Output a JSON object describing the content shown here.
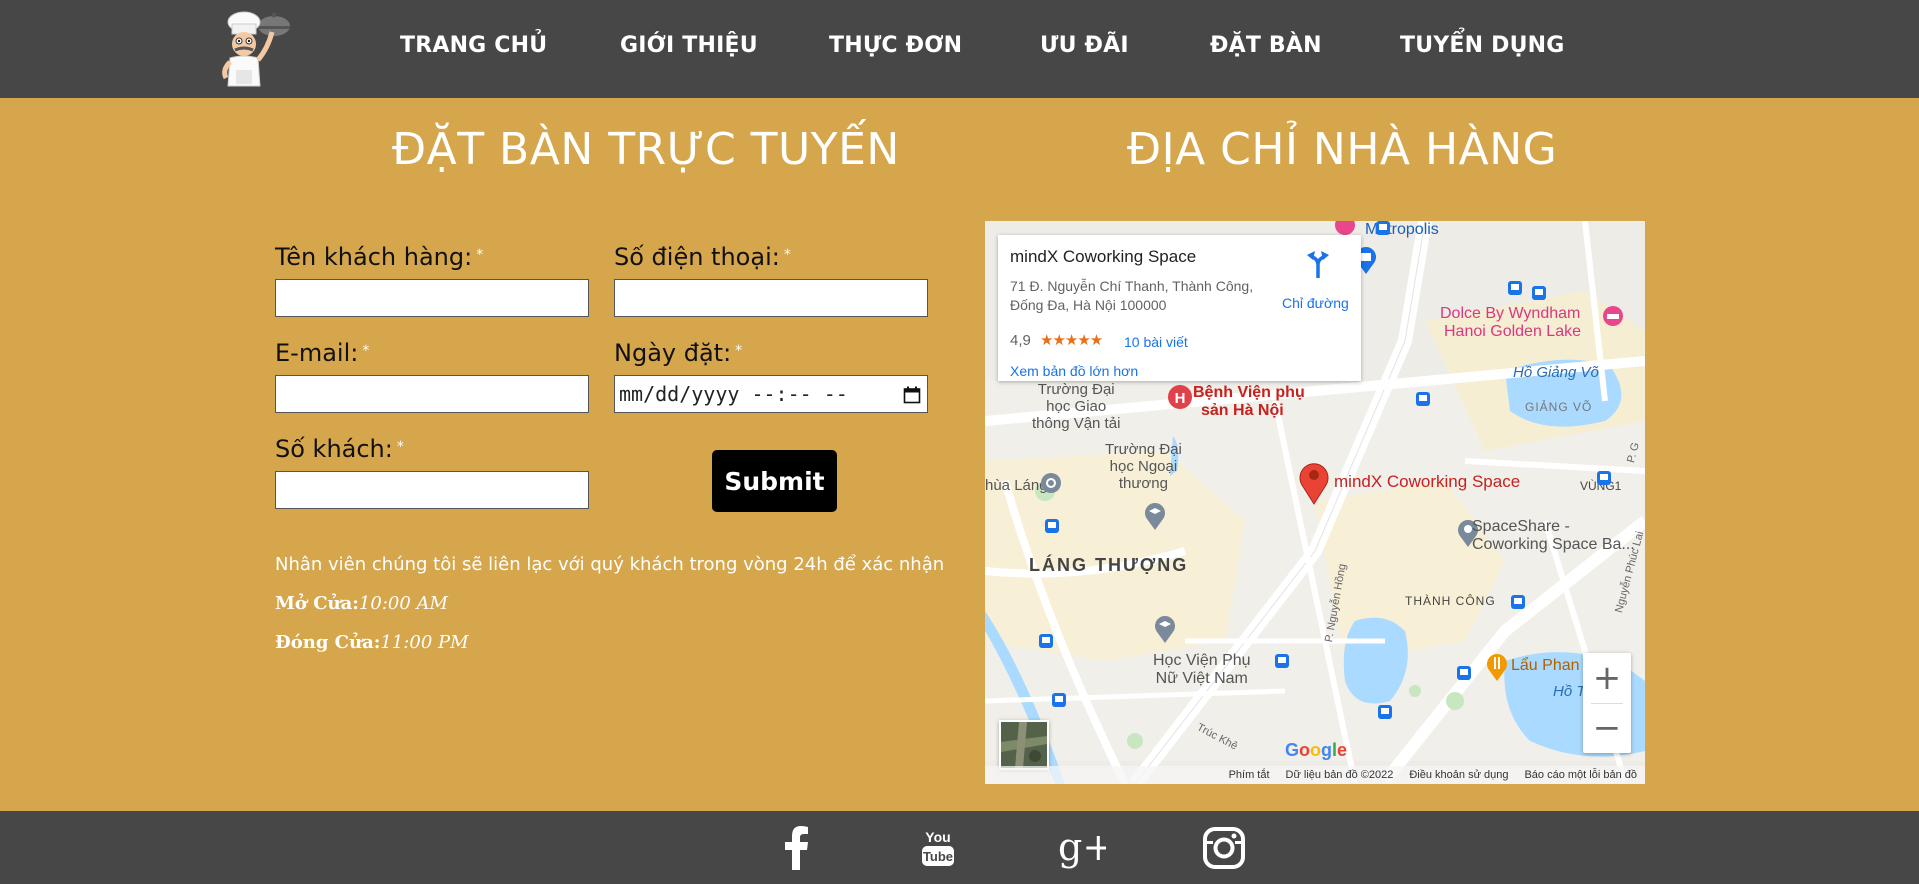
{
  "nav": {
    "items": [
      {
        "label": "TRANG CHỦ"
      },
      {
        "label": "GIỚI THIỆU"
      },
      {
        "label": "THỰC ĐƠN"
      },
      {
        "label": "ƯU ĐÃI"
      },
      {
        "label": "ĐẶT BÀN"
      },
      {
        "label": "TUYỂN DỤNG"
      }
    ]
  },
  "booking": {
    "title": "ĐẶT BÀN TRỰC TUYẾN",
    "required_mark": "*",
    "fields": {
      "name": {
        "label": "Tên khách hàng:",
        "value": ""
      },
      "phone": {
        "label": "Số điện thoại:",
        "value": ""
      },
      "email": {
        "label": "E-mail:",
        "value": ""
      },
      "date": {
        "label": "Ngày đặt:",
        "placeholder": "mm/dd/yyyy --:-- --"
      },
      "guests": {
        "label": "Số khách:",
        "value": ""
      }
    },
    "submit_label": "Submit",
    "note": "Nhân viên chúng tôi sẽ liên lạc với quý khách trong vòng 24h để xác nhận",
    "open_label": "Mở Cửa:",
    "open_time": "10:00 AM",
    "close_label": "Đóng Cửa:",
    "close_time": "11:00 PM"
  },
  "address": {
    "title": "ĐỊA CHỈ NHÀ HÀNG"
  },
  "map": {
    "card": {
      "name": "mindX Coworking Space",
      "address": "71 Đ. Nguyễn Chí Thanh, Thành Công, Đống Đa, Hà Nội 100000",
      "rating": "4,9",
      "stars": "★★★★★",
      "reviews": "10 bài viết",
      "larger_map": "Xem bản đồ lớn hơn",
      "directions": "Chỉ đường"
    },
    "labels": {
      "metropolis": "Metropolis",
      "dolce1": "Dolce By Wyndham",
      "dolce2": "Hanoi Golden Lake",
      "ho_giang_vo": "Hồ Giảng Võ",
      "giang_vo": "GIẢNG VÕ",
      "truong_dai_hoc_gtvt1": "Trường Đại",
      "truong_dai_hoc_gtvt2": "học Giao",
      "truong_dai_hoc_gtvt3": "thông Vận tải",
      "benh_vien1": "Bệnh Viện phụ",
      "benh_vien2": "sản Hà Nội",
      "truong_nn1": "Trường Đại",
      "truong_nn2": "học Ngoại",
      "truong_nn3": "thương",
      "chua_lang": "hùa Láng",
      "pin_label": "mindX Coworking Space",
      "vung1": "VÙNG1",
      "spaceshare1": "SpaceShare -",
      "spaceshare2": "Coworking Space Ba...",
      "lang_thuong": "LÁNG THƯỢNG",
      "thanh_cong": "THÀNH CÔNG",
      "hoc_vien1": "Học Viện Phụ",
      "hoc_vien2": "Nữ Việt Nam",
      "lau_phan": "Lẩu Phan",
      "ho_partial": "Hồ T",
      "nguyen_hong": "P. Nguyễn Hồng",
      "truc_khe": "Trúc Khê",
      "nguyen_phuc_lai": "Nguyễn Phúc Lai",
      "p_g": "P. G",
      "google": "Google"
    },
    "attribution": [
      "Phím tắt",
      "Dữ liệu bản đồ ©2022",
      "Điều khoản sử dụng",
      "Báo cáo một lỗi bản đồ"
    ],
    "zoom_in": "+",
    "zoom_out": "−"
  },
  "colors": {
    "background": "#d6a64c",
    "header": "#474747",
    "footer": "#474747"
  },
  "social": [
    "facebook-icon",
    "youtube-icon",
    "google-plus-icon",
    "instagram-icon"
  ],
  "social_text": {
    "youtube_top": "You",
    "youtube_bottom": "Tube",
    "gplus": "g+"
  }
}
